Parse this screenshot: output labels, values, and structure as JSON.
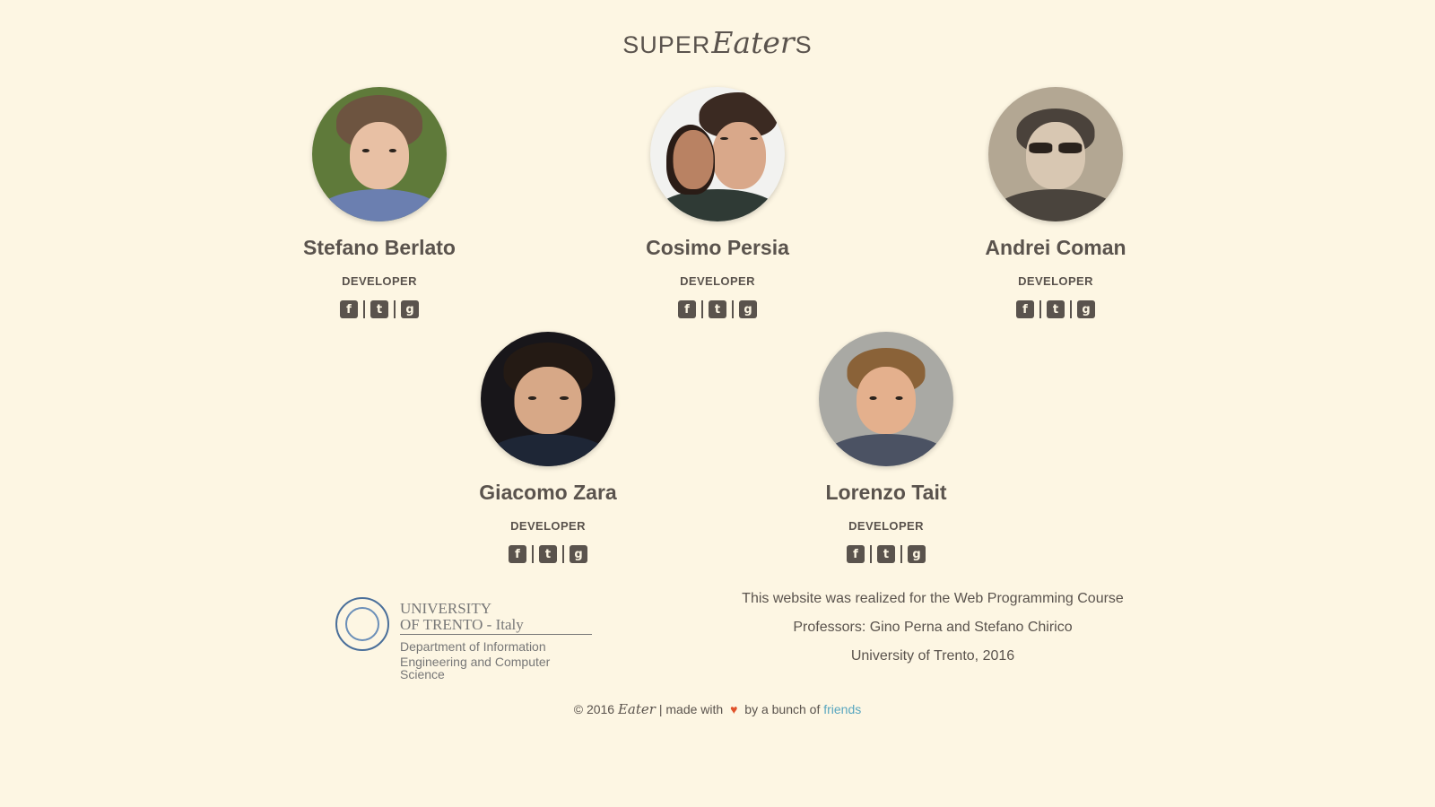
{
  "brand": {
    "prefix": "SUPER",
    "script": "Eater",
    "suffix": "S"
  },
  "social_icons": [
    "facebook-icon",
    "twitter-icon",
    "google-plus-icon"
  ],
  "team": [
    {
      "name": "Stefano Berlato",
      "role": "DEVELOPER"
    },
    {
      "name": "Cosimo Persia",
      "role": "DEVELOPER"
    },
    {
      "name": "Andrei Coman",
      "role": "DEVELOPER"
    },
    {
      "name": "Giacomo Zara",
      "role": "DEVELOPER"
    },
    {
      "name": "Lorenzo Tait",
      "role": "DEVELOPER"
    }
  ],
  "university_logo": {
    "line1": "UNIVERSITY",
    "line2": "OF TRENTO - Italy",
    "line3": "Department of Information",
    "line4": "Engineering and Computer Science"
  },
  "credits": {
    "line1": "This website was realized for the Web Programming Course",
    "line2": "Professors: Gino Perna and Stefano Chirico",
    "line3": "University of Trento, 2016"
  },
  "footer": {
    "copyright": "© 2016",
    "script": "Eater",
    "made_with": "| made with",
    "by": "by a bunch of",
    "link": "friends"
  },
  "colors": {
    "background": "#fdf6e3",
    "text": "#5a534d",
    "heart": "#e0522b",
    "link": "#58a6bf"
  }
}
